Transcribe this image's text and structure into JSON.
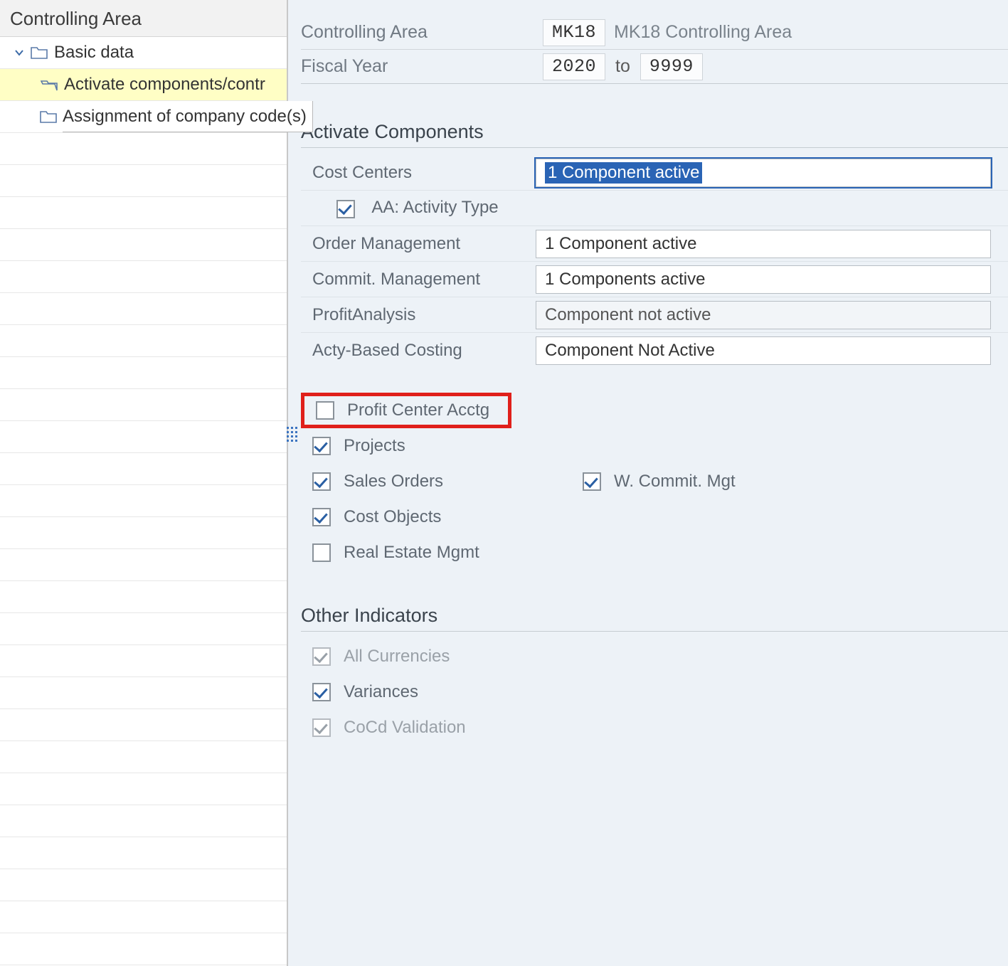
{
  "sidebar": {
    "title": "Controlling Area",
    "nodes": {
      "root": {
        "label": "Basic data"
      },
      "child0": {
        "label": "Activate components/control indicators"
      },
      "child1": {
        "label": "Assignment of company code(s)"
      }
    }
  },
  "header": {
    "controlling_area_label": "Controlling Area",
    "controlling_area_value": "MK18",
    "controlling_area_desc": "MK18 Controlling Area",
    "fiscal_year_label": "Fiscal Year",
    "fiscal_year_from": "2020",
    "fiscal_year_to_label": "to",
    "fiscal_year_to": "9999"
  },
  "activate": {
    "title": "Activate Components",
    "rows": {
      "cost_centers": {
        "label": "Cost Centers",
        "value": "1 Component active"
      },
      "aa_activity": {
        "label": "AA: Activity Type"
      },
      "order_mgmt": {
        "label": "Order Management",
        "value": "1 Component active"
      },
      "commit_mgmt": {
        "label": "Commit. Management",
        "value": "1 Components active"
      },
      "profit_analysis": {
        "label": "ProfitAnalysis",
        "value": "Component not active"
      },
      "abc": {
        "label": "Acty-Based Costing",
        "value": "Component Not Active"
      }
    },
    "checks": {
      "pca": "Profit Center Acctg",
      "projects": "Projects",
      "sales_orders": "Sales Orders",
      "w_commit": "W. Commit. Mgt",
      "cost_objects": "Cost Objects",
      "real_estate": "Real Estate Mgmt"
    }
  },
  "other": {
    "title": "Other Indicators",
    "checks": {
      "all_currencies": "All Currencies",
      "variances": "Variances",
      "cocd": "CoCd Validation"
    }
  }
}
